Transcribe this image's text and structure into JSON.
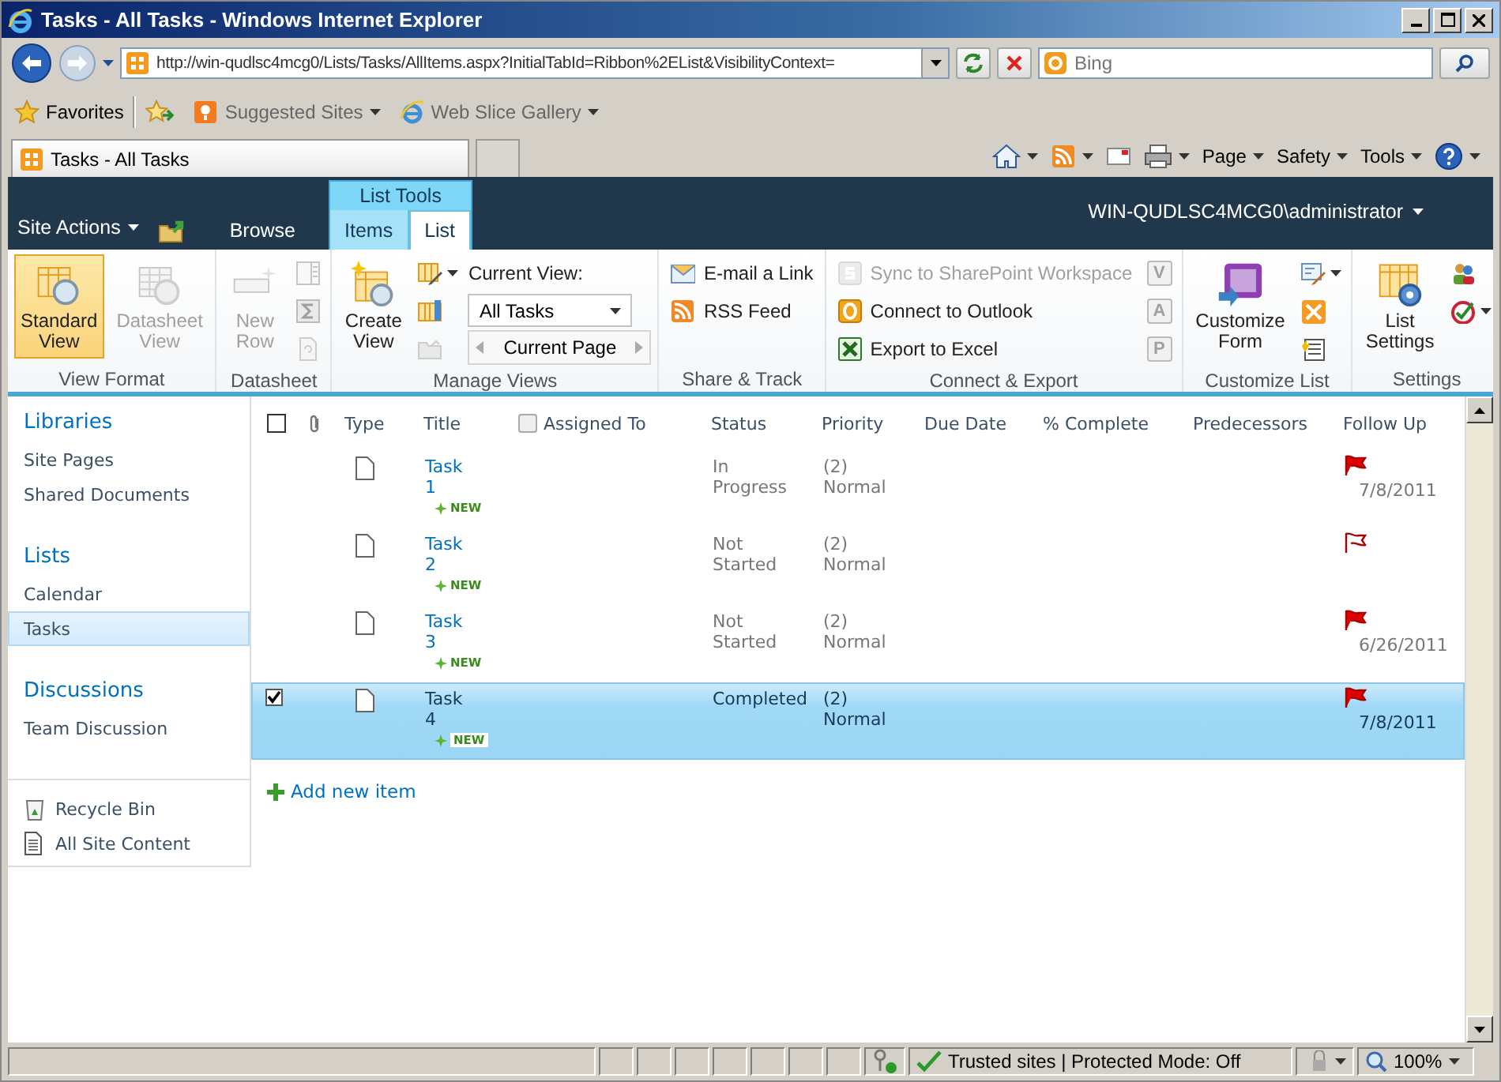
{
  "window": {
    "title": "Tasks - All Tasks - Windows Internet Explorer"
  },
  "address_bar": {
    "value": "http://win-qudlsc4mcg0/Lists/Tasks/AllItems.aspx?InitialTabId=Ribbon%2EList&VisibilityContext="
  },
  "search": {
    "placeholder": "Bing"
  },
  "favorites_bar": {
    "label": "Favorites",
    "links": [
      {
        "label": "Suggested Sites"
      },
      {
        "label": "Web Slice Gallery"
      }
    ]
  },
  "browser_tabs": [
    {
      "label": "Tasks - All Tasks",
      "selected": true
    }
  ],
  "command_bar": {
    "menus": [
      {
        "label": "Page"
      },
      {
        "label": "Safety"
      },
      {
        "label": "Tools"
      }
    ]
  },
  "site_header": {
    "site_actions": "Site Actions",
    "context_group": "List Tools",
    "user": "WIN-QUDLSC4MCG0\\administrator",
    "tabs": [
      {
        "label": "Browse",
        "kind": "plain",
        "selected": false
      },
      {
        "label": "Items",
        "kind": "context",
        "selected": false
      },
      {
        "label": "List",
        "kind": "context",
        "selected": true
      }
    ]
  },
  "ribbon": {
    "groups": [
      {
        "label": "View Format",
        "columns": [
          [
            {
              "kind": "large",
              "label": "Standard View",
              "selected": true,
              "disabled": false
            }
          ],
          [
            {
              "kind": "large",
              "label": "Datasheet View",
              "selected": false,
              "disabled": true
            }
          ]
        ]
      },
      {
        "label": "Datasheet",
        "columns": [
          [
            {
              "kind": "large",
              "label": "New Row",
              "selected": false,
              "disabled": true
            }
          ],
          [
            {
              "kind": "icon",
              "disabled": true
            },
            {
              "kind": "icon",
              "disabled": true
            },
            {
              "kind": "icon",
              "disabled": true
            }
          ]
        ]
      },
      {
        "label": "Manage Views",
        "columns": [
          [
            {
              "kind": "large",
              "label": "Create View",
              "selected": false,
              "disabled": false
            }
          ],
          [
            {
              "kind": "icon-menu",
              "disabled": false
            },
            {
              "kind": "icon",
              "disabled": false
            },
            {
              "kind": "icon",
              "disabled": true
            }
          ],
          [
            {
              "kind": "caption",
              "label": "Current View:"
            },
            {
              "kind": "select",
              "label": "All Tasks"
            },
            {
              "kind": "pager",
              "label": "Current Page"
            }
          ]
        ]
      },
      {
        "label": "Share & Track",
        "columns": [
          [
            {
              "kind": "small",
              "label": "E-mail a Link",
              "disabled": false
            },
            {
              "kind": "small",
              "label": "RSS Feed",
              "disabled": false
            }
          ]
        ]
      },
      {
        "label": "Connect & Export",
        "columns": [
          [
            {
              "kind": "small",
              "label": "Sync to SharePoint Workspace",
              "disabled": true
            },
            {
              "kind": "small",
              "label": "Connect to Outlook",
              "disabled": false
            },
            {
              "kind": "small",
              "label": "Export to Excel",
              "disabled": false
            }
          ],
          [
            {
              "kind": "letter",
              "label": "V",
              "disabled": true
            },
            {
              "kind": "letter",
              "label": "A",
              "disabled": true
            },
            {
              "kind": "letter",
              "label": "P",
              "disabled": true
            }
          ]
        ]
      },
      {
        "label": "Customize List",
        "columns": [
          [
            {
              "kind": "large",
              "label": "Customize Form",
              "selected": false,
              "disabled": false
            }
          ],
          [
            {
              "kind": "icon-menu",
              "disabled": false
            },
            {
              "kind": "icon",
              "disabled": false
            },
            {
              "kind": "icon",
              "disabled": false
            }
          ]
        ]
      },
      {
        "label": "Settings",
        "columns": [
          [
            {
              "kind": "large",
              "label": "List Settings",
              "selected": false,
              "disabled": false
            }
          ],
          [
            {
              "kind": "icon",
              "disabled": false
            },
            {
              "kind": "icon-menu",
              "disabled": false
            }
          ]
        ]
      }
    ]
  },
  "navigation": {
    "sections": [
      {
        "heading": "Libraries",
        "items": [
          {
            "label": "Site Pages",
            "selected": false
          },
          {
            "label": "Shared Documents",
            "selected": false
          }
        ]
      },
      {
        "heading": "Lists",
        "items": [
          {
            "label": "Calendar",
            "selected": false
          },
          {
            "label": "Tasks",
            "selected": true
          }
        ]
      },
      {
        "heading": "Discussions",
        "items": [
          {
            "label": "Team Discussion",
            "selected": false
          }
        ]
      }
    ],
    "footer_links": [
      {
        "label": "Recycle Bin"
      },
      {
        "label": "All Site Content"
      }
    ]
  },
  "table": {
    "columns": [
      {
        "kind": "checkbox",
        "checked": false
      },
      {
        "kind": "attachment"
      },
      {
        "kind": "text",
        "label": "Type"
      },
      {
        "kind": "text",
        "label": "Title"
      },
      {
        "kind": "check-text",
        "label": "Assigned To",
        "checked": false
      },
      {
        "kind": "text",
        "label": "Status"
      },
      {
        "kind": "text",
        "label": "Priority"
      },
      {
        "kind": "text",
        "label": "Due Date"
      },
      {
        "kind": "text",
        "label": "% Complete"
      },
      {
        "kind": "text",
        "label": "Predecessors"
      },
      {
        "kind": "text",
        "label": "Follow Up"
      }
    ],
    "rows": [
      {
        "selected": false,
        "title": "Task 1",
        "badge": "NEW",
        "status": "In Progress",
        "priority": "(2) Normal",
        "flagged": true,
        "follow_up": "7/8/2011"
      },
      {
        "selected": false,
        "title": "Task 2",
        "badge": "NEW",
        "status": "Not Started",
        "priority": "(2) Normal",
        "flagged": false
      },
      {
        "selected": false,
        "title": "Task 3",
        "badge": "NEW",
        "status": "Not Started",
        "priority": "(2) Normal",
        "flagged": true,
        "follow_up": "6/26/2011"
      },
      {
        "selected": true,
        "title": "Task 4",
        "badge": "NEW",
        "status": "Completed",
        "priority": "(2) Normal",
        "flagged": true,
        "follow_up": "7/8/2011"
      }
    ]
  },
  "add_item": {
    "label": "Add new item"
  },
  "status_bar": {
    "zone": "Trusted sites | Protected Mode: Off",
    "zoom": "100%"
  }
}
